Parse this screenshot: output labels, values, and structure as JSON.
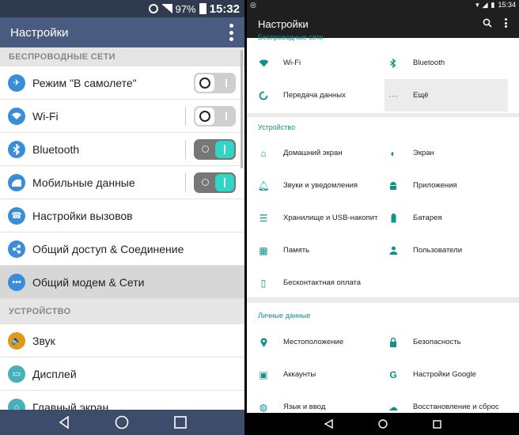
{
  "left": {
    "status": {
      "battery": "97%",
      "time": "15:32"
    },
    "title": "Настройки",
    "sections": [
      {
        "header": "БЕСПРОВОДНЫЕ СЕТИ",
        "items": [
          {
            "label": "Режим \"В самолете\"",
            "icon": "airplane-icon",
            "toggle": "off"
          },
          {
            "label": "Wi-Fi",
            "icon": "wifi-icon",
            "toggle": "off"
          },
          {
            "label": "Bluetooth",
            "icon": "bluetooth-icon",
            "toggle": "on"
          },
          {
            "label": "Мобильные данные",
            "icon": "mobile-data-icon",
            "toggle": "on"
          },
          {
            "label": "Настройки вызовов",
            "icon": "phone-icon"
          },
          {
            "label": "Общий доступ & Соединение",
            "icon": "share-icon"
          },
          {
            "label": "Общий модем & Сети",
            "icon": "tethering-icon"
          }
        ]
      },
      {
        "header": "УСТРОЙСТВО",
        "items": [
          {
            "label": "Звук",
            "icon": "sound-icon"
          },
          {
            "label": "Дисплей",
            "icon": "display-icon"
          },
          {
            "label": "Главный экран",
            "icon": "home-icon"
          }
        ]
      }
    ]
  },
  "right": {
    "status": {
      "time": "15:34"
    },
    "title": "Настройки",
    "wireless": {
      "header": "Беспроводные сети",
      "items": [
        {
          "label": "Wi-Fi",
          "icon": "wifi-icon"
        },
        {
          "label": "Bluetooth",
          "icon": "bluetooth-icon"
        },
        {
          "label": "Передача данных",
          "icon": "data-usage-icon"
        },
        {
          "label": "Ещё",
          "icon": "more-horiz-icon"
        }
      ]
    },
    "device": {
      "header": "Устройство",
      "items": [
        {
          "label": "Домашний экран",
          "icon": "home-icon"
        },
        {
          "label": "Экран",
          "icon": "brightness-icon"
        },
        {
          "label": "Звуки и уведомления",
          "icon": "bell-icon"
        },
        {
          "label": "Приложения",
          "icon": "android-icon"
        },
        {
          "label": "Хранилище и USB-накопит",
          "icon": "storage-icon"
        },
        {
          "label": "Батарея",
          "icon": "battery-icon"
        },
        {
          "label": "Память",
          "icon": "memory-icon"
        },
        {
          "label": "Пользователи",
          "icon": "person-icon"
        },
        {
          "label": "Бесконтактная оплата",
          "icon": "nfc-icon"
        }
      ]
    },
    "personal": {
      "header": "Личные данные",
      "items": [
        {
          "label": "Местоположение",
          "icon": "location-icon"
        },
        {
          "label": "Безопасность",
          "icon": "lock-icon"
        },
        {
          "label": "Аккаунты",
          "icon": "account-icon"
        },
        {
          "label": "Настройки Google",
          "icon": "google-icon"
        },
        {
          "label": "Язык и ввод",
          "icon": "globe-icon"
        },
        {
          "label": "Восстановление и сброс",
          "icon": "backup-icon"
        }
      ]
    }
  },
  "colors": {
    "lg_appbar": "#4a5b80",
    "lg_statusbar": "#2f3a4f",
    "toggle_on": "#2fd6c6",
    "android_accent": "#0d9488"
  }
}
